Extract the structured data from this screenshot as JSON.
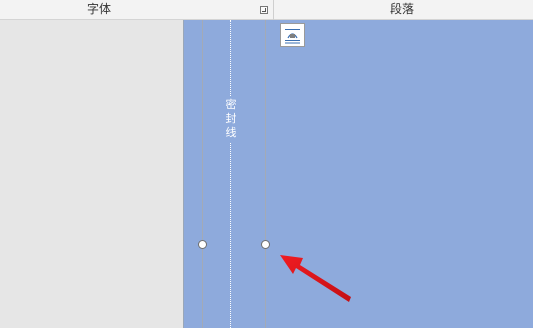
{
  "ribbon": {
    "font_group_label": "字体",
    "paragraph_group_label": "段落",
    "launcher_icon": "dialog-launcher-icon"
  },
  "document": {
    "seal_line_text": "密封线",
    "background_color": "#8eaadc",
    "layout_options_icon": "layout-options-icon"
  },
  "annotation": {
    "arrow_color": "#e8141b",
    "arrow_icon": "red-arrow"
  }
}
